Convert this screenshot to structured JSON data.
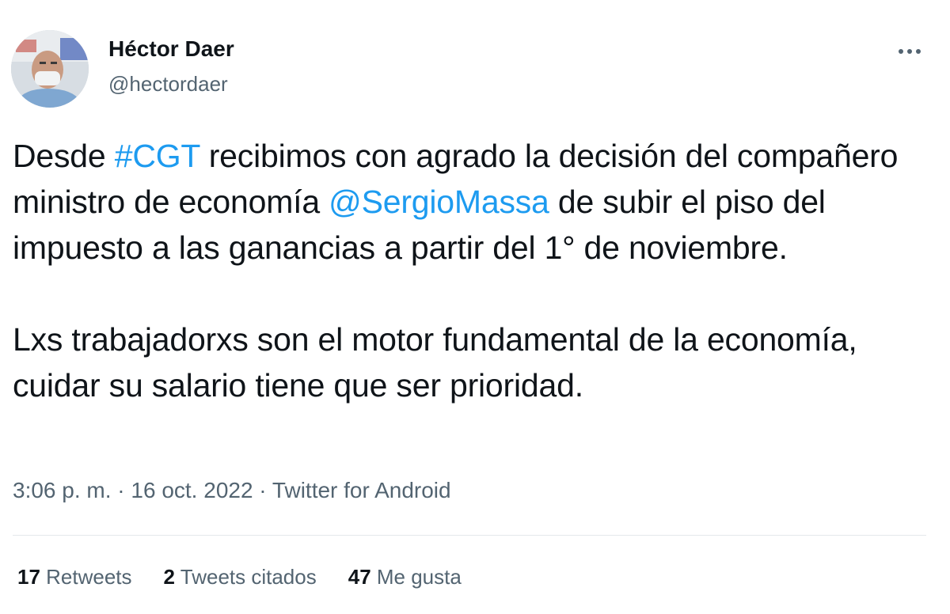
{
  "author": {
    "display_name": "Héctor Daer",
    "handle": "@hectordaer"
  },
  "more_icon": "more-horizontal-icon",
  "tweet": {
    "p1_pre": "Desde ",
    "p1_hashtag": "#CGT",
    "p1_mid": " recibimos con agrado la decisión del compañero ministro de economía ",
    "p1_mention": "@SergioMassa",
    "p1_post": " de subir el piso del impuesto a las ganancias a partir del 1° de noviembre.",
    "p2": "Lxs trabajadorxs son el motor fundamental de la economía, cuidar su salario tiene que ser prioridad."
  },
  "meta": {
    "time": "3:06 p. m.",
    "separator": " · ",
    "date": "16 oct. 2022",
    "source": "Twitter for Android"
  },
  "stats": {
    "retweets": {
      "count": "17",
      "label": " Retweets"
    },
    "quotes": {
      "count": "2",
      "label": " Tweets citados"
    },
    "likes": {
      "count": "47",
      "label": " Me gusta"
    }
  },
  "colors": {
    "link": "#1d9bf0",
    "text": "#0f1419",
    "secondary": "#536471",
    "divider": "#e4e8eb"
  }
}
